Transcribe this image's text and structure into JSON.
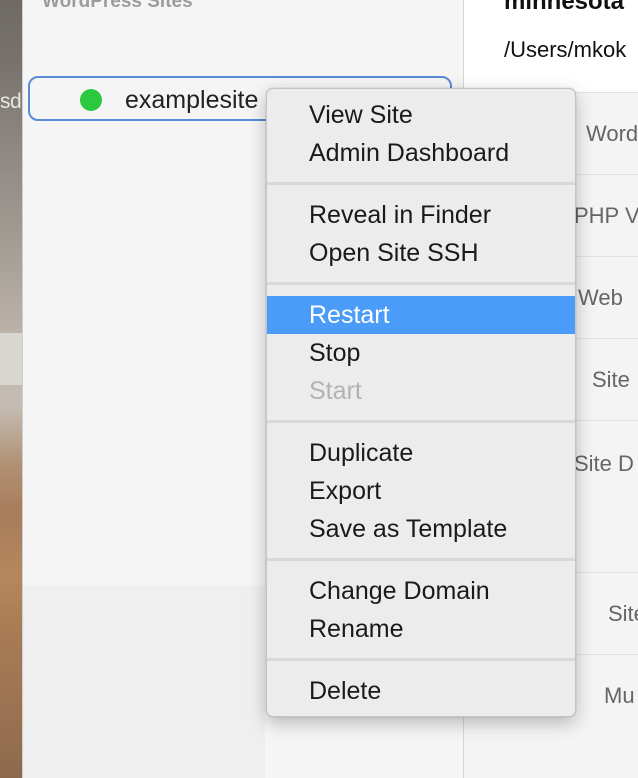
{
  "sidebar": {
    "heading": "WordPress Sites",
    "sites": [
      {
        "name": "examplesite",
        "status": "running",
        "status_color": "#2bc840"
      }
    ]
  },
  "desktop": {
    "partial_text": "sd"
  },
  "detail": {
    "title": "minnesota",
    "path": "/Users/mkok",
    "row_labels": [
      "Word",
      "PHP V",
      "Web",
      "Site",
      "Site D",
      "Site",
      "Mu"
    ]
  },
  "context_menu": {
    "highlight_color": "#4b9bf8",
    "groups": [
      {
        "items": [
          {
            "label": "View Site"
          },
          {
            "label": "Admin Dashboard"
          }
        ]
      },
      {
        "items": [
          {
            "label": "Reveal in Finder"
          },
          {
            "label": "Open Site SSH"
          }
        ]
      },
      {
        "items": [
          {
            "label": "Restart",
            "state": "highlighted"
          },
          {
            "label": "Stop"
          },
          {
            "label": "Start",
            "state": "disabled"
          }
        ]
      },
      {
        "items": [
          {
            "label": "Duplicate"
          },
          {
            "label": "Export"
          },
          {
            "label": "Save as Template"
          }
        ]
      },
      {
        "items": [
          {
            "label": "Change Domain"
          },
          {
            "label": "Rename"
          }
        ]
      },
      {
        "items": [
          {
            "label": "Delete"
          }
        ]
      }
    ]
  }
}
